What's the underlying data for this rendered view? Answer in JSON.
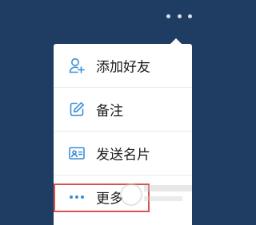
{
  "colors": {
    "background": "#1f3c62",
    "menu_bg": "#ffffff",
    "accent_icon": "#3b8fd6",
    "text": "#1a1a1a",
    "highlight_border": "#d9534f"
  },
  "top_bar": {
    "more_icon": "more-horizontal-icon"
  },
  "menu": {
    "items": [
      {
        "label": "添加好友",
        "icon": "add-friend-icon"
      },
      {
        "label": "备注",
        "icon": "edit-icon"
      },
      {
        "label": "发送名片",
        "icon": "contact-card-icon"
      },
      {
        "label": "更多",
        "icon": "more-horizontal-icon"
      }
    ]
  }
}
